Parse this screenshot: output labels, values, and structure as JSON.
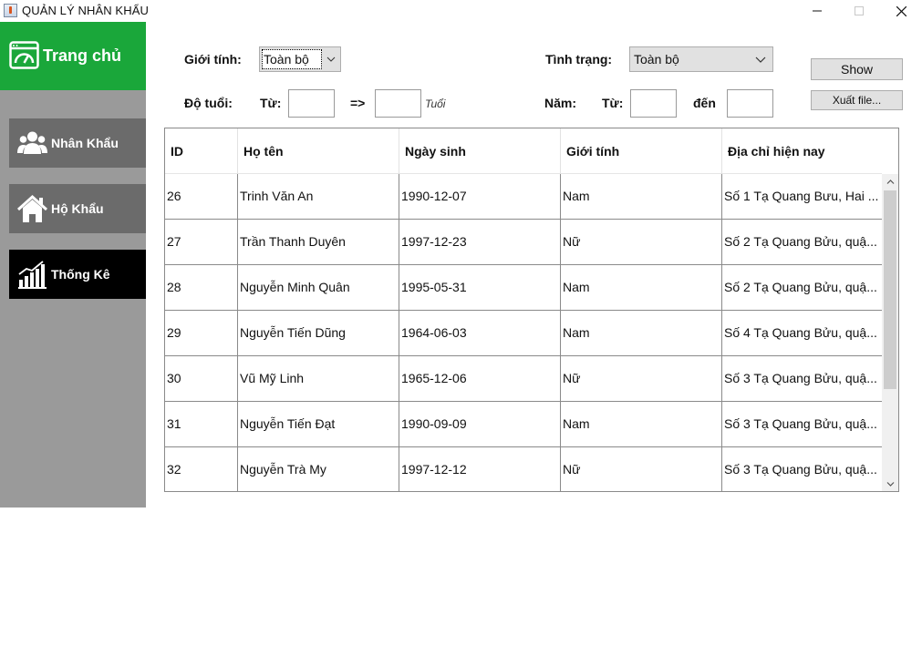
{
  "window": {
    "title": "QUẢN LÝ NHÂN KHẨU"
  },
  "sidebar": {
    "home": {
      "label": "Trang chủ",
      "icon": "dashboard-icon"
    },
    "items": [
      {
        "label": "Nhân Khẩu",
        "icon": "people-icon",
        "active": false
      },
      {
        "label": "Hộ Khẩu",
        "icon": "house-icon",
        "active": false
      },
      {
        "label": "Thống Kê",
        "icon": "bar-chart-icon",
        "active": true
      }
    ]
  },
  "filters": {
    "gender_label": "Giới tính:",
    "gender_value": "Toàn bộ",
    "status_label": "Tình trạng:",
    "status_value": "Toàn bộ",
    "age_label": "Độ tuổi:",
    "from_label": "Từ:",
    "arrow_label": "=>",
    "age_unit": "Tuổi",
    "year_label": "Năm:",
    "year_from_label": "Từ:",
    "year_to_label": "đến",
    "age_from": "",
    "age_to": "",
    "year_from": "",
    "year_to": ""
  },
  "actions": {
    "show_label": "Show",
    "export_label": "Xuất file..."
  },
  "table": {
    "columns": [
      "ID",
      "Họ tên",
      "Ngày sinh",
      "Giới tính",
      "Địa chỉ hiện nay"
    ],
    "rows": [
      [
        "26",
        "Trinh Văn An",
        "1990-12-07",
        "Nam",
        "Số 1 Tạ Quang Bưu, Hai ..."
      ],
      [
        "27",
        "Trần Thanh Duyên",
        "1997-12-23",
        "Nữ",
        "Số 2 Tạ Quang Bửu, quậ..."
      ],
      [
        "28",
        "Nguyễn Minh Quân",
        "1995-05-31",
        "Nam",
        "Số 2 Tạ Quang Bửu, quậ..."
      ],
      [
        "29",
        "Nguyễn Tiến Dũng",
        "1964-06-03",
        "Nam",
        "Số 4 Tạ Quang Bửu, quậ..."
      ],
      [
        "30",
        "Vũ Mỹ Linh",
        "1965-12-06",
        "Nữ",
        "Số 3 Tạ Quang Bửu, quậ..."
      ],
      [
        "31",
        "Nguyễn Tiến Đạt",
        "1990-09-09",
        "Nam",
        "Số 3 Tạ Quang Bửu, quậ..."
      ],
      [
        "32",
        "Nguyễn Trà My",
        "1997-12-12",
        "Nữ",
        "Số 3 Tạ Quang Bửu, quậ..."
      ]
    ]
  },
  "colors": {
    "home_green": "#1aa73a",
    "sidebar_gray": "#9a9a9a",
    "nav_gray": "#6b6b6b",
    "nav_active": "#000000"
  }
}
